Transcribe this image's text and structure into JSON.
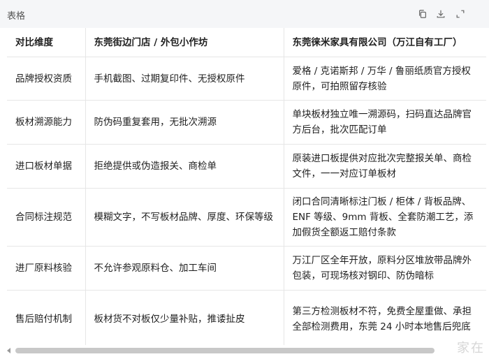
{
  "window": {
    "title": "表格"
  },
  "icons": {
    "copy": "copy-icon",
    "download": "download-icon",
    "collapse": "collapse-icon"
  },
  "table": {
    "headers": [
      "对比维度",
      "东莞街边门店 / 外包小作坊",
      "东莞徕米家具有限公司（万江自有工厂）"
    ],
    "rows": [
      [
        "品牌授权资质",
        "手机截图、过期复印件、无授权原件",
        "爱格 / 克诺斯邦 / 万华 / 鲁丽纸质官方授权原件，可拍照留存核验"
      ],
      [
        "板材溯源能力",
        "防伪码重复套用，无批次溯源",
        "单块板材独立唯一溯源码，扫码直达品牌官方后台，批次匹配订单"
      ],
      [
        "进口板材单据",
        "拒绝提供或伪造报关、商检单",
        "原装进口板提供对应批次完整报关单、商检文件，一一对应订单板材"
      ],
      [
        "合同标注规范",
        "模糊文字，不写板材品牌、厚度、环保等级",
        "闭口合同清晰标注门板 / 柜体 / 背板品牌、ENF 等级、9mm 背板、全套防潮工艺，添加假货全额返工赔付条款"
      ],
      [
        "进厂原料核验",
        "不允许参观原料仓、加工车间",
        "万江厂区全年开放，原料分区堆放带品牌外包装，可现场核对钢印、防伪暗标"
      ],
      [
        "售后赔付机制",
        "板材货不对板仅少量补贴，推诿扯皮",
        "第三方检测板材不符，免费全屋重做、承担全部检测费用，东莞 24 小时本地售后兜底"
      ]
    ]
  },
  "watermark": "家在"
}
